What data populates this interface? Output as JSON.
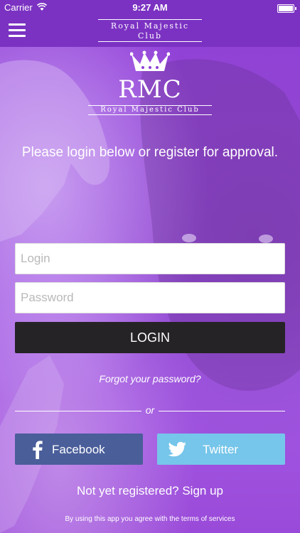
{
  "status_bar": {
    "carrier": "Carrier",
    "time": "9:27 AM"
  },
  "nav": {
    "title_line1": "Royal Majestic",
    "title_line2": "Club"
  },
  "logo": {
    "mark": "RMC",
    "subtitle": "Royal Majestic Club"
  },
  "intro": "Please login below or register for approval.",
  "form": {
    "login_placeholder": "Login",
    "login_value": "",
    "password_placeholder": "Password",
    "password_value": "",
    "login_button": "LOGIN"
  },
  "forgot_password": "Forgot your password?",
  "divider_text": "or",
  "social": {
    "facebook": "Facebook",
    "twitter": "Twitter"
  },
  "signup": "Not yet registered? Sign up",
  "terms": "By using this app you agree with the terms of services",
  "colors": {
    "accent": "#7b32c2",
    "facebook": "#4a5e9a",
    "twitter": "#76c5ea",
    "button_dark": "#262326"
  }
}
